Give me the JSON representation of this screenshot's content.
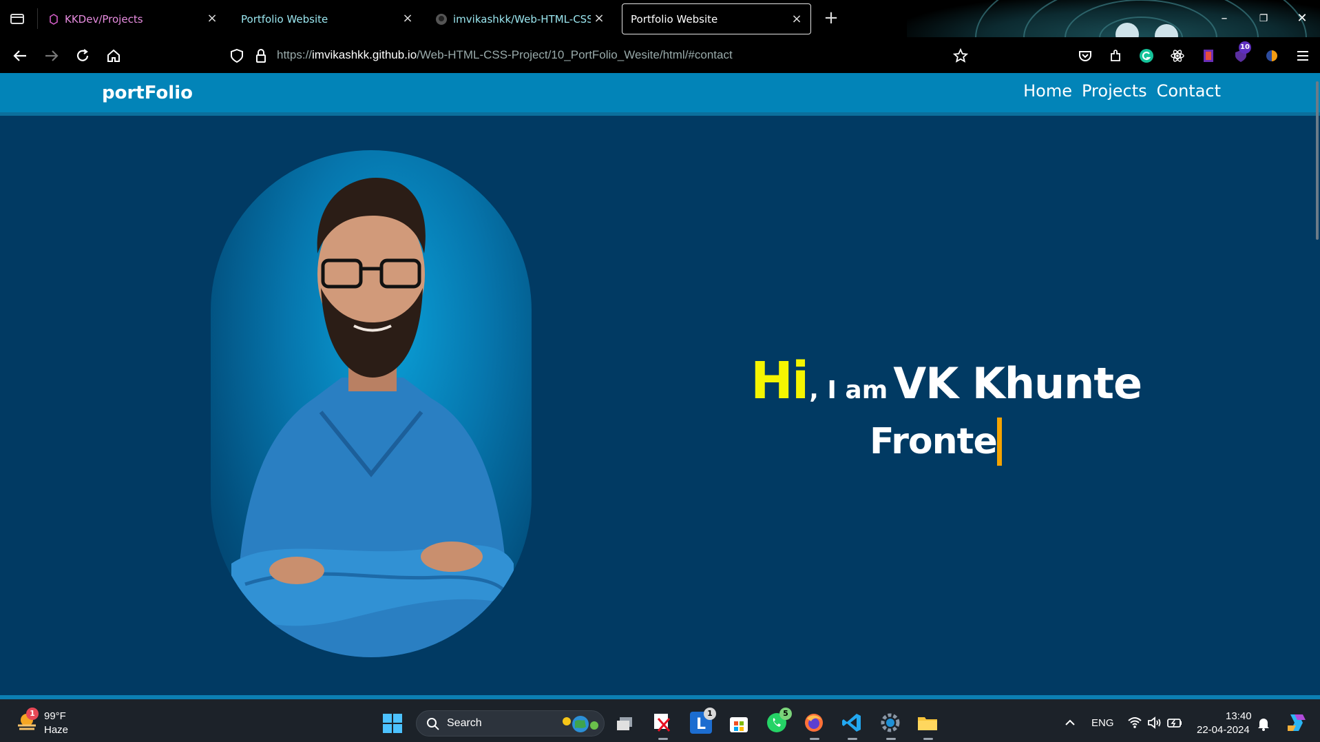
{
  "browser": {
    "tabs": [
      {
        "title": "KKDev/Projects",
        "active": false
      },
      {
        "title": "Portfolio Website",
        "active": false
      },
      {
        "title": "imvikashkk/Web-HTML-CSS-Pr",
        "active": false
      },
      {
        "title": "Portfolio Website",
        "active": true
      }
    ],
    "url": {
      "scheme": "https://",
      "host": "imvikashkk.github.io",
      "path": "/Web-HTML-CSS-Project/10_PortFolio_Wesite/html/#contact"
    },
    "extensions_badge": "10"
  },
  "site": {
    "logo": "portFolio",
    "nav": [
      "Home",
      "Projects",
      "Contact"
    ],
    "hero": {
      "hi": "Hi",
      "i_am": ", I am",
      "name": "VK Khunte",
      "typed_text": "Fronte"
    }
  },
  "taskbar": {
    "weather": {
      "temp": "99°F",
      "desc": "Haze",
      "badge": "1"
    },
    "search_label": "Search",
    "badges": {
      "lively": "1",
      "whatsapp": "5"
    },
    "lang": "ENG",
    "time": "13:40",
    "date": "22-04-2024"
  },
  "colors": {
    "page_bg": "#013a63",
    "header_bg": "#0284b8",
    "hi_yellow": "#f5f500",
    "caret": "#f5a300"
  }
}
